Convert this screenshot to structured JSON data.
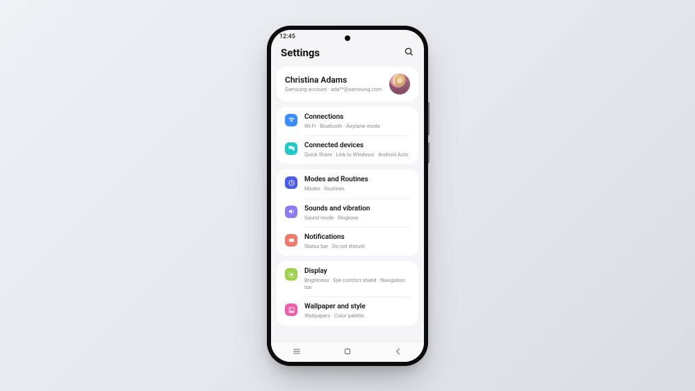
{
  "statusbar": {
    "time": "12:45"
  },
  "header": {
    "title": "Settings"
  },
  "account": {
    "name": "Christina Adams",
    "subtitle": "Samsung account · ada**@samsung.com"
  },
  "groups": [
    {
      "items": [
        {
          "icon": "wifi",
          "color": "#3a8cff",
          "title": "Connections",
          "desc": "Wi-Fi · Bluetooth · Airplane mode"
        },
        {
          "icon": "devices",
          "color": "#1ec9c9",
          "title": "Connected devices",
          "desc": "Quick Share · Link to Windows · Android Auto"
        }
      ]
    },
    {
      "items": [
        {
          "icon": "routines",
          "color": "#4a5de8",
          "title": "Modes and Routines",
          "desc": "Modes · Routines"
        },
        {
          "icon": "sound",
          "color": "#8f7bf0",
          "title": "Sounds and vibration",
          "desc": "Sound mode · Ringtone"
        },
        {
          "icon": "notify",
          "color": "#f07a6a",
          "title": "Notifications",
          "desc": "Status bar · Do not disturb"
        }
      ]
    },
    {
      "items": [
        {
          "icon": "display",
          "color": "#9ed24a",
          "title": "Display",
          "desc": "Brightness · Eye comfort shield · Navigation bar"
        },
        {
          "icon": "wallpaper",
          "color": "#ef5da8",
          "title": "Wallpaper and style",
          "desc": "Wallpapers · Color palette"
        }
      ]
    }
  ]
}
